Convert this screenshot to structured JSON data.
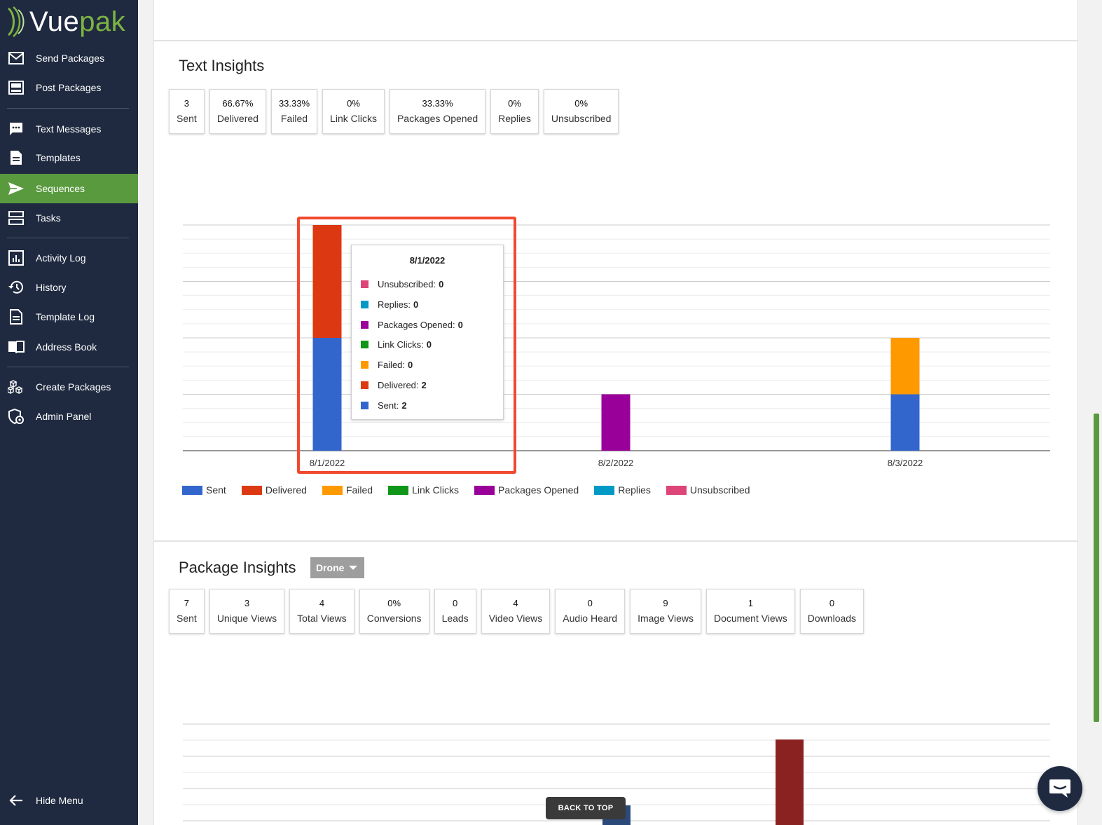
{
  "brand": {
    "part1": "Vue",
    "part2": "pak",
    "green": "#7cb342"
  },
  "sidebar": {
    "items": [
      {
        "label": "Send Packages",
        "icon": "envelope-icon"
      },
      {
        "label": "Post Packages",
        "icon": "monitor-icon"
      },
      {
        "label": "Text Messages",
        "icon": "chat-bubble-icon"
      },
      {
        "label": "Templates",
        "icon": "document-icon"
      },
      {
        "label": "Sequences",
        "icon": "paper-plane-icon",
        "active": true
      },
      {
        "label": "Tasks",
        "icon": "tasks-icon"
      },
      {
        "label": "Activity Log",
        "icon": "bar-chart-icon"
      },
      {
        "label": "History",
        "icon": "history-icon"
      },
      {
        "label": "Template Log",
        "icon": "document-icon"
      },
      {
        "label": "Address Book",
        "icon": "book-icon"
      },
      {
        "label": "Create Packages",
        "icon": "boxes-icon"
      },
      {
        "label": "Admin Panel",
        "icon": "shield-gear-icon"
      }
    ],
    "hide_menu": "Hide Menu",
    "active_color": "#5a9a3f"
  },
  "text_insights": {
    "title": "Text Insights",
    "stats": [
      {
        "value": "3",
        "label": "Sent"
      },
      {
        "value": "66.67%",
        "label": "Delivered"
      },
      {
        "value": "33.33%",
        "label": "Failed"
      },
      {
        "value": "0%",
        "label": "Link Clicks"
      },
      {
        "value": "33.33%",
        "label": "Packages Opened"
      },
      {
        "value": "0%",
        "label": "Replies"
      },
      {
        "value": "0%",
        "label": "Unsubscribed"
      }
    ]
  },
  "chart_data": {
    "type": "bar",
    "stacked": true,
    "categories": [
      "8/1/2022",
      "8/2/2022",
      "8/3/2022"
    ],
    "series": [
      {
        "name": "Sent",
        "color": "#3366cc",
        "values": [
          2,
          0,
          1
        ]
      },
      {
        "name": "Delivered",
        "color": "#dc3912",
        "values": [
          2,
          0,
          0
        ]
      },
      {
        "name": "Failed",
        "color": "#ff9900",
        "values": [
          0,
          0,
          1
        ]
      },
      {
        "name": "Link Clicks",
        "color": "#109618",
        "values": [
          0,
          0,
          0
        ]
      },
      {
        "name": "Packages Opened",
        "color": "#990099",
        "values": [
          0,
          1,
          0
        ]
      },
      {
        "name": "Replies",
        "color": "#0099c6",
        "values": [
          0,
          0,
          0
        ]
      },
      {
        "name": "Unsubscribed",
        "color": "#dd4477",
        "values": [
          0,
          0,
          0
        ]
      }
    ],
    "ylim": [
      0,
      4
    ],
    "grid": true,
    "legend": "bottom",
    "tooltip": {
      "title": "8/1/2022",
      "rows": [
        {
          "name": "Unsubscribed",
          "value": "0",
          "color": "#dd4477"
        },
        {
          "name": "Replies",
          "value": "0",
          "color": "#0099c6"
        },
        {
          "name": "Packages Opened",
          "value": "0",
          "color": "#990099"
        },
        {
          "name": "Link Clicks",
          "value": "0",
          "color": "#109618"
        },
        {
          "name": "Failed",
          "value": "0",
          "color": "#ff9900"
        },
        {
          "name": "Delivered",
          "value": "2",
          "color": "#dc3912"
        },
        {
          "name": "Sent",
          "value": "2",
          "color": "#3366cc"
        }
      ]
    }
  },
  "package_insights": {
    "title": "Package Insights",
    "filter": "Drone",
    "stats": [
      {
        "value": "7",
        "label": "Sent"
      },
      {
        "value": "3",
        "label": "Unique Views"
      },
      {
        "value": "4",
        "label": "Total Views"
      },
      {
        "value": "0%",
        "label": "Conversions"
      },
      {
        "value": "0",
        "label": "Leads"
      },
      {
        "value": "4",
        "label": "Video Views"
      },
      {
        "value": "0",
        "label": "Audio Heard"
      },
      {
        "value": "9",
        "label": "Image Views"
      },
      {
        "value": "1",
        "label": "Document Views"
      },
      {
        "value": "0",
        "label": "Downloads"
      }
    ]
  },
  "back_to_top": "BACK TO TOP"
}
